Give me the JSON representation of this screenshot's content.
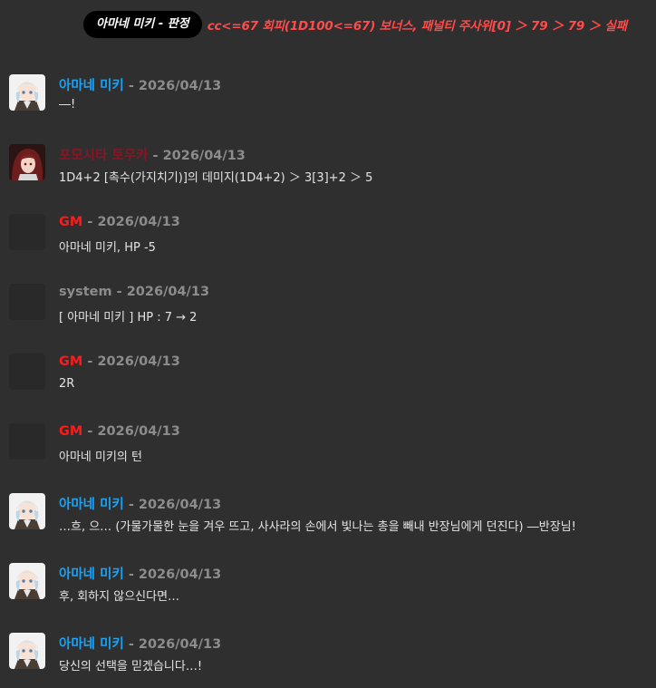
{
  "roll": {
    "speaker": "아마네 미키 - 판정",
    "result": "cc<=67 회피(1D100<=67) 보너스, 패널티 주사위[0] ＞ 79 ＞ 79 ＞ 실패"
  },
  "colors": {
    "background": "#2f2f2f",
    "amane": "#1da1f2",
    "shikishima": "#8e1322",
    "gm": "#ff1a1a",
    "system": "#8c8c8c",
    "roll_text": "#ff4b4b"
  },
  "messages": [
    {
      "name": "아마네 미키",
      "date": "- 2026/04/13",
      "text": "―!",
      "avatar": "amane-avatar",
      "name_color": "#1da1f2"
    },
    {
      "name": "포모시타 토우카",
      "date": "- 2026/04/13",
      "text": "1D4+2 [촉수(가지치기)]의 데미지(1D4+2) ＞ 3[3]+2 ＞ 5",
      "avatar": "redhair-avatar",
      "name_color": "#8e1322"
    },
    {
      "name": "GM",
      "date": "- 2026/04/13",
      "text": "아마네 미키, HP -5",
      "avatar": "blank-avatar",
      "name_color": "#ff1a1a"
    },
    {
      "name": "system",
      "date": "- 2026/04/13",
      "text": "[ 아마네 미키 ] HP : 7 → 2",
      "avatar": "blank-avatar",
      "name_color": "#8c8c8c"
    },
    {
      "name": "GM",
      "date": "- 2026/04/13",
      "text": "2R",
      "avatar": "blank-avatar",
      "name_color": "#ff1a1a"
    },
    {
      "name": "GM",
      "date": "- 2026/04/13",
      "text": "아마네 미키의 턴",
      "avatar": "blank-avatar",
      "name_color": "#ff1a1a"
    },
    {
      "name": "아마네 미키",
      "date": "- 2026/04/13",
      "text": "…흐, 으… (가물가물한 눈을 겨우 뜨고, 사사라의 손에서 빛나는 총을 빼내 반장님에게 던진다) ―반장님!",
      "avatar": "amane-avatar",
      "name_color": "#1da1f2"
    },
    {
      "name": "아마네 미키",
      "date": "- 2026/04/13",
      "text": "후, 회하지 않으신다면…",
      "avatar": "amane-avatar",
      "name_color": "#1da1f2"
    },
    {
      "name": "아마네 미키",
      "date": "- 2026/04/13",
      "text": "당신의 선택을 믿겠습니다…!",
      "avatar": "amane-avatar",
      "name_color": "#1da1f2"
    }
  ]
}
